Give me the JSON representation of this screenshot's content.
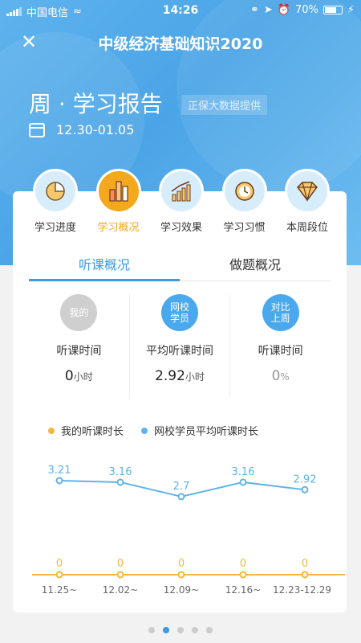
{
  "status_bar": {
    "carrier": "中国电信",
    "time": "14:26",
    "battery": "70%",
    "battery_level": 0.7
  },
  "nav": {
    "title": "中级经济基础知识2020"
  },
  "report": {
    "title": "周 · 学习报告",
    "badge": "正保大数据提供",
    "date_range": "12.30-01.05"
  },
  "categories": [
    {
      "label": "学习进度",
      "icon": "pie-chart-icon"
    },
    {
      "label": "学习概况",
      "icon": "bar-chart-icon",
      "active": true
    },
    {
      "label": "学习效果",
      "icon": "growth-chart-icon"
    },
    {
      "label": "学习习惯",
      "icon": "clock-icon"
    },
    {
      "label": "本周段位",
      "icon": "diamond-icon"
    }
  ],
  "tabs": [
    {
      "label": "听课概况",
      "active": true
    },
    {
      "label": "做题概况"
    }
  ],
  "stats": [
    {
      "icon_text": "我的",
      "label": "听课时间",
      "value": "0",
      "unit": "小时",
      "icon_color": "#cfcfcf"
    },
    {
      "icon_text": "网校学员",
      "label": "平均听课时间",
      "value": "2.92",
      "unit": "小时",
      "icon_color": "#4aa8ec"
    },
    {
      "icon_text": "对比上周",
      "label": "听课时间",
      "value": "0",
      "unit": "%",
      "icon_color": "#4aa8ec"
    }
  ],
  "colors": {
    "accent": "#3a9be3",
    "my_series": "#f0b93a",
    "avg_series": "#5fb3ea"
  },
  "chart_data": {
    "type": "line",
    "categories": [
      "11.25~",
      "12.02~",
      "12.09~",
      "12.16~",
      "12.23-12.29"
    ],
    "series": [
      {
        "name": "我的听课时长",
        "values": [
          0,
          0,
          0,
          0,
          0
        ],
        "color": "#f0b93a"
      },
      {
        "name": "网校学员平均听课时长",
        "values": [
          3.21,
          3.16,
          2.7,
          3.16,
          2.92
        ],
        "color": "#5fb3ea"
      }
    ],
    "value_labels": [
      [
        "0",
        "0",
        "0",
        "0",
        "0"
      ],
      [
        "3.21",
        "3.16",
        "2.7",
        "3.16",
        "2.92"
      ]
    ],
    "legend": "top"
  },
  "pager": {
    "count": 5,
    "active": 1
  }
}
